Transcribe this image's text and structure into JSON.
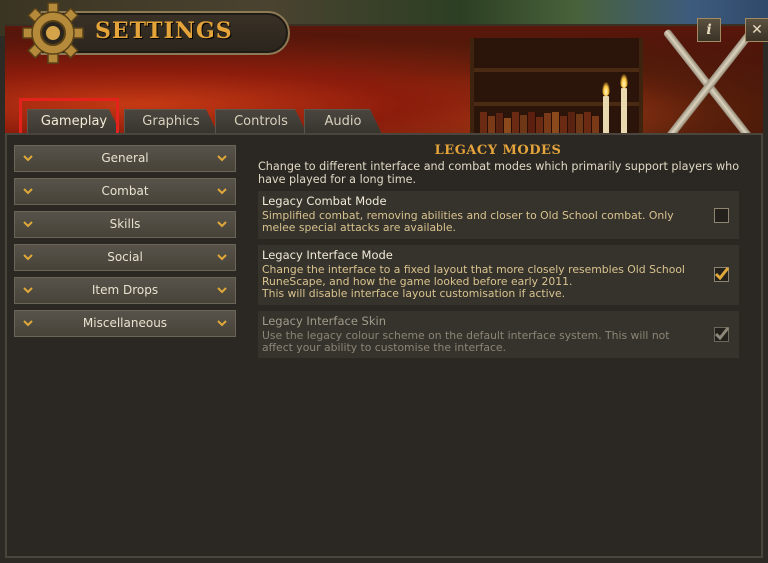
{
  "window": {
    "title": "SETTINGS",
    "info_button": "i",
    "close_button": "✕"
  },
  "tabs": [
    {
      "label": "Gameplay",
      "active": true
    },
    {
      "label": "Graphics",
      "active": false
    },
    {
      "label": "Controls",
      "active": false
    },
    {
      "label": "Audio",
      "active": false
    }
  ],
  "sidebar": {
    "items": [
      {
        "label": "General"
      },
      {
        "label": "Combat"
      },
      {
        "label": "Skills"
      },
      {
        "label": "Social"
      },
      {
        "label": "Item Drops"
      },
      {
        "label": "Miscellaneous"
      }
    ]
  },
  "section": {
    "title": "LEGACY MODES",
    "description": "Change to different interface and combat modes which primarily support players who have played for a long time."
  },
  "settings": [
    {
      "name": "Legacy Combat Mode",
      "description": "Simplified combat, removing abilities and closer to Old School combat. Only melee special attacks are available.",
      "checked": false,
      "enabled": true
    },
    {
      "name": "Legacy Interface Mode",
      "description": "Change the interface to a fixed layout that more closely resembles Old School RuneScape, and how the game looked before early 2011.\nThis will disable interface layout customisation if active.",
      "checked": true,
      "enabled": true
    },
    {
      "name": "Legacy Interface Skin",
      "description": "Use the legacy colour scheme on the default interface system. This will not affect your ability to customise the interface.",
      "checked": true,
      "enabled": false
    }
  ],
  "colors": {
    "accent_gold": "#e5a43a",
    "highlight_red": "#e3221c",
    "panel_bg": "#2b2824"
  }
}
